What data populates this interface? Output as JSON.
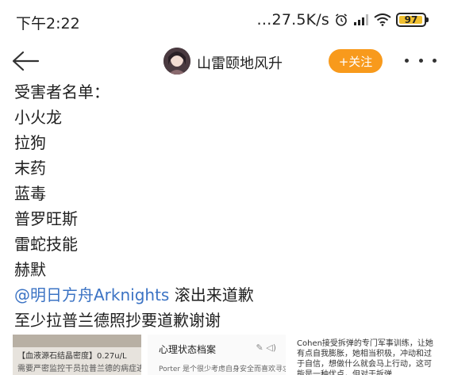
{
  "status_bar": {
    "time": "下午2:22",
    "net_speed": "…27.5K/s",
    "battery": "97",
    "battery_level": 0.97,
    "alarm_icon": "alarm-icon",
    "signal_icon": "signal-icon",
    "wifi_icon": "wifi-icon"
  },
  "header": {
    "back_icon": "back-arrow-icon",
    "user_name": "山雷颐地风升",
    "follow_label": "+关注",
    "more_icon": "more-icon",
    "accent_color": "#f89a1c"
  },
  "post": {
    "heading": "受害者名单：",
    "victims": [
      "小火龙",
      "拉狗",
      "末药",
      "蓝毒",
      "普罗旺斯",
      "雷蛇技能",
      "赫默"
    ],
    "mention": "@明日方舟Arknights",
    "mention_suffix": " 滚出来道歉",
    "mention_color": "#3b73c4",
    "last_line": "至少拉普兰德照抄要道歉谢谢"
  },
  "images": {
    "img1_line1": "【血液源石结晶密度】0.27u/L",
    "img1_line2": "需要严密监控干员拉普兰德的病症进程",
    "img2_title": "心理状态档案",
    "img2_text": "Porter 是个很少考虑自身安全而喜欢寻求",
    "img3_line1": "Cohen接受拆弹的专门军事训练，让她",
    "img3_line2": "有点自我膨胀，她相当积极，冲动和过",
    "img3_line3": "于自信，想做什么就会马上行动，这可",
    "img3_line4": "能是一种优点，但对于拆弹"
  }
}
